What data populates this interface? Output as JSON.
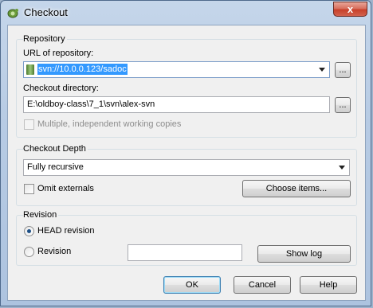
{
  "window": {
    "title": "Checkout",
    "close_glyph": "x"
  },
  "repository": {
    "group_label": "Repository",
    "url_label": "URL of repository:",
    "url_value": "svn://10.0.0.123/sadoc",
    "url_browse": "...",
    "dir_label": "Checkout directory:",
    "dir_value": "E:\\oldboy-class\\7_1\\svn\\alex-svn",
    "dir_browse": "...",
    "multiple_label": "Multiple, independent working copies",
    "multiple_checked": false
  },
  "depth": {
    "group_label": "Checkout Depth",
    "selected": "Fully recursive",
    "omit_label": "Omit externals",
    "omit_checked": false,
    "choose_items": "Choose items..."
  },
  "revision": {
    "group_label": "Revision",
    "head_label": "HEAD revision",
    "rev_label": "Revision",
    "rev_value": "",
    "show_log": "Show log"
  },
  "buttons": {
    "ok": "OK",
    "cancel": "Cancel",
    "help": "Help"
  },
  "icons": {
    "app": "tortoise-svn-icon",
    "repo": "repository-icon"
  }
}
